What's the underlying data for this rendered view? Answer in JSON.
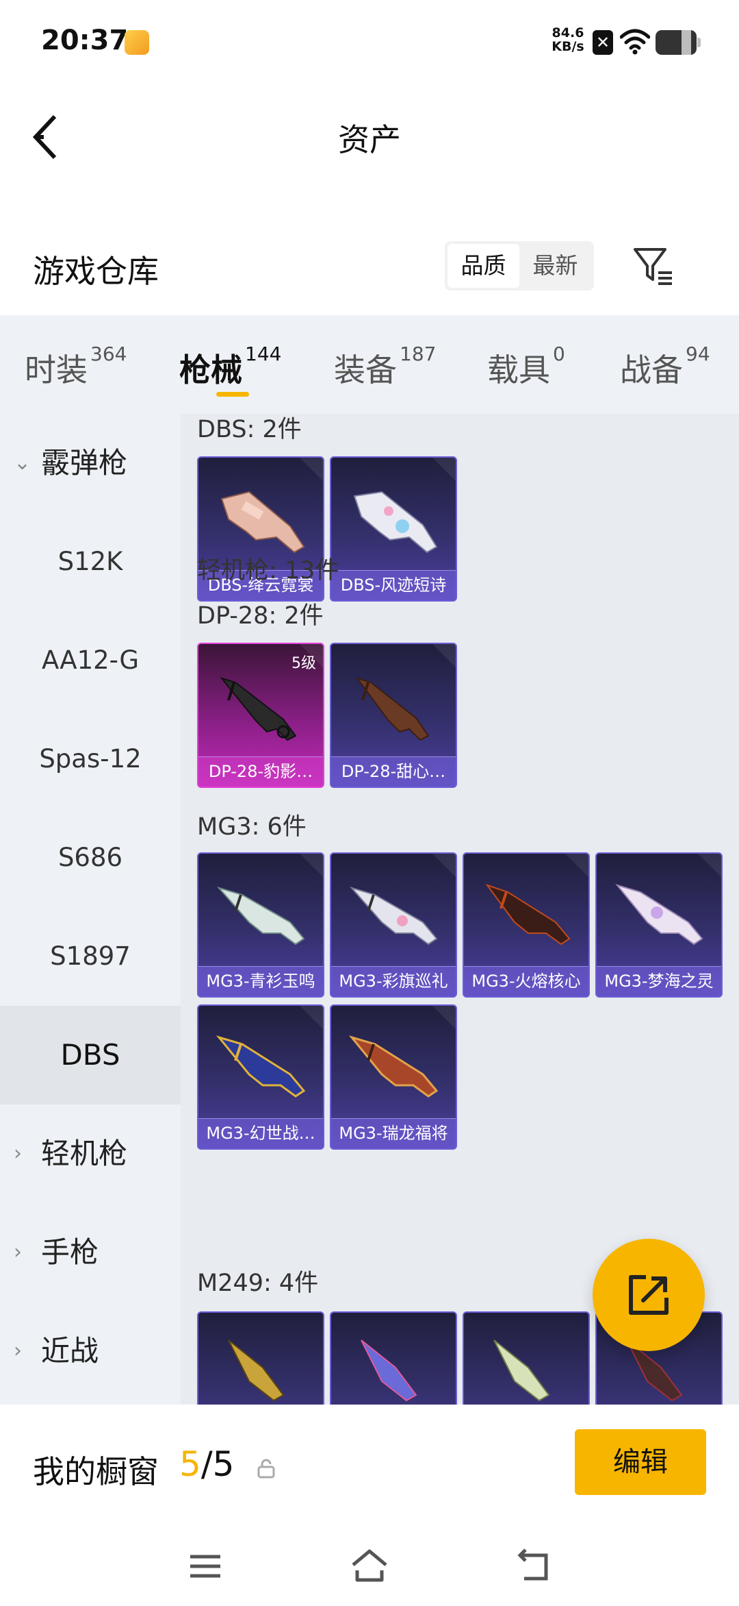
{
  "status_bar": {
    "time": "20:37",
    "speed_value": "84.6",
    "speed_unit": "KB/s",
    "icons": [
      "app-notification-icon",
      "close-box-icon",
      "wifi-icon",
      "battery-icon"
    ]
  },
  "header": {
    "title": "资产"
  },
  "warehouse": {
    "title": "游戏仓库",
    "sort_options": [
      "品质",
      "最新"
    ],
    "sort_selected": "品质"
  },
  "tabs": [
    {
      "label": "时装",
      "count": "364"
    },
    {
      "label": "枪械",
      "count": "144"
    },
    {
      "label": "装备",
      "count": "187"
    },
    {
      "label": "载具",
      "count": "0"
    },
    {
      "label": "战备",
      "count": "94"
    }
  ],
  "sidebar": {
    "expanded_category": "霰弹枪",
    "sub_items": [
      "S12K",
      "AA12-G",
      "Spas-12",
      "S686",
      "S1897",
      "DBS"
    ],
    "selected_sub_item": "DBS",
    "collapsed_categories": [
      "轻机枪",
      "手枪",
      "近战"
    ]
  },
  "content": {
    "groups": [
      {
        "label": "DBS: 2件",
        "cards": [
          {
            "name": "DBS-绛云霓裳",
            "level": ""
          },
          {
            "name": "DBS-风迹短诗",
            "level": ""
          }
        ]
      },
      {
        "label": "轻机枪: 13件",
        "cards": []
      },
      {
        "label": "DP-28: 2件",
        "cards": [
          {
            "name": "DP-28-豹影…",
            "level": "5级"
          },
          {
            "name": "DP-28-甜心…",
            "level": ""
          }
        ]
      },
      {
        "label": "MG3: 6件",
        "cards": [
          {
            "name": "MG3-青衫玉鸣",
            "level": ""
          },
          {
            "name": "MG3-彩旗巡礼",
            "level": ""
          },
          {
            "name": "MG3-火熔核心",
            "level": ""
          },
          {
            "name": "MG3-梦海之灵",
            "level": ""
          },
          {
            "name": "MG3-幻世战…",
            "level": ""
          },
          {
            "name": "MG3-瑞龙福将",
            "level": ""
          }
        ]
      },
      {
        "label": "M249: 4件",
        "cards": []
      }
    ]
  },
  "showcase": {
    "title": "我的橱窗",
    "current": "5",
    "separator": "/",
    "total": "5",
    "edit_label": "编辑"
  },
  "colors": {
    "accent": "#f7b500",
    "card_purple": "#34306c",
    "card_pink": "#c12bb8",
    "panel_bg": "#eef2f6"
  }
}
